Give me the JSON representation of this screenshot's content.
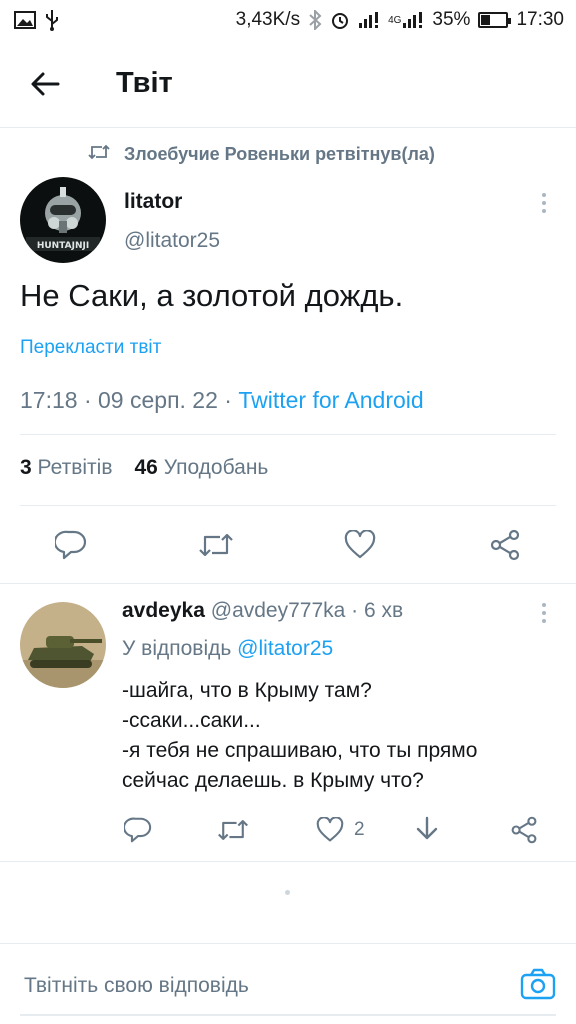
{
  "status_bar": {
    "speed": "3,43K/s",
    "battery_percent": "35%",
    "battery_level": 0.35,
    "time": "17:30",
    "network": "4G",
    "icons": [
      "image-icon",
      "usb-icon",
      "bluetooth-icon",
      "alarm-icon",
      "signal-icon",
      "signal-4g-icon",
      "battery-icon"
    ]
  },
  "header": {
    "title": "Твіт",
    "back_icon": "arrow-left-icon"
  },
  "retweet_context": {
    "text": "Злоебучие Ровеньки ретвітнув(ла)",
    "icon": "retweet-icon"
  },
  "tweet": {
    "author_name": "litator",
    "author_handle": "@litator25",
    "text": "Не Саки, а золотой дождь.",
    "translate": "Перекласти твіт",
    "time": "17:18",
    "date": "09 серп. 22",
    "separator": "·",
    "client": "Twitter for Android",
    "retweets_count": "3",
    "retweets_label": "Ретвітів",
    "likes_count": "46",
    "likes_label": "Уподобань",
    "avatar_text": "HUNTAJNJI",
    "actions": [
      "reply-icon",
      "retweet-icon",
      "like-icon",
      "share-icon"
    ]
  },
  "reply": {
    "author_name": "avdeyka",
    "author_handle": "@avdey777ka",
    "separator": "·",
    "time_ago": "6 хв",
    "reply_to_label": "У відповідь",
    "reply_to_handle": "@litator25",
    "lines": [
      "-шайга, что в Крыму там?",
      "-ссаки...саки...",
      "-я тебя не спрашиваю, что ты прямо",
      "сейчас делаешь. в Крыму что?"
    ],
    "likes_count": "2",
    "actions": [
      "reply-icon",
      "retweet-icon",
      "like-icon",
      "download-icon",
      "share-icon"
    ]
  },
  "composer": {
    "placeholder": "Твітніть свою відповідь",
    "camera_icon": "camera-icon"
  },
  "colors": {
    "accent": "#1da1f2",
    "secondary_text": "#657786",
    "primary_text": "#14171a",
    "divider": "#e6ecf0"
  }
}
